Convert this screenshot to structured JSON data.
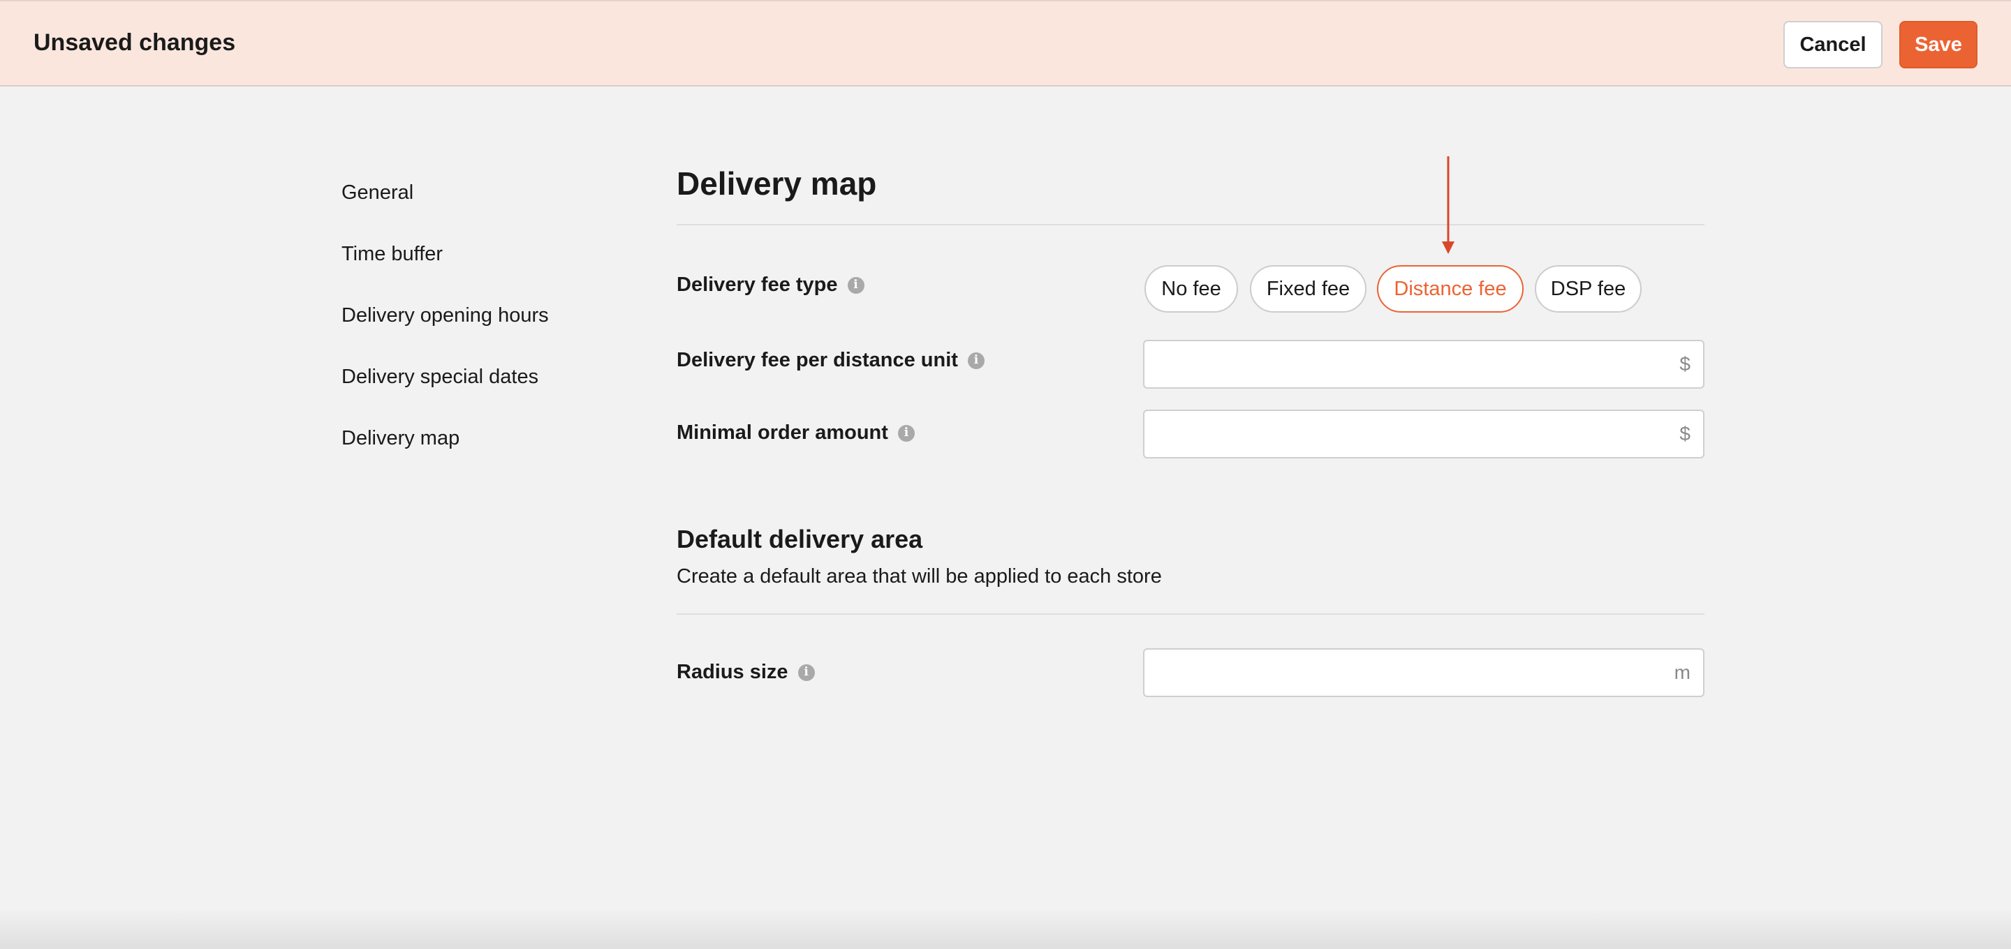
{
  "topbar": {
    "title": "Unsaved changes",
    "cancel_label": "Cancel",
    "save_label": "Save",
    "accent_color": "#ec6333",
    "background_color": "#fbe6dd"
  },
  "sidebar": {
    "items": [
      {
        "label": "General"
      },
      {
        "label": "Time buffer"
      },
      {
        "label": "Delivery opening hours"
      },
      {
        "label": "Delivery special dates"
      },
      {
        "label": "Delivery map"
      }
    ]
  },
  "main": {
    "title": "Delivery map",
    "fee_type": {
      "label": "Delivery fee type",
      "options": [
        "No fee",
        "Fixed fee",
        "Distance fee",
        "DSP fee"
      ],
      "selected": "Distance fee"
    },
    "fee_per_distance": {
      "label": "Delivery fee per distance unit",
      "value": "",
      "suffix": "$"
    },
    "min_order": {
      "label": "Minimal order amount",
      "value": "",
      "suffix": "$"
    },
    "default_area": {
      "title": "Default delivery area",
      "description": "Create a default area that will be applied to each store"
    },
    "radius": {
      "label": "Radius size",
      "value": "",
      "suffix": "m"
    },
    "info_icon": "info-icon",
    "annotation_color": "#d9472b"
  }
}
